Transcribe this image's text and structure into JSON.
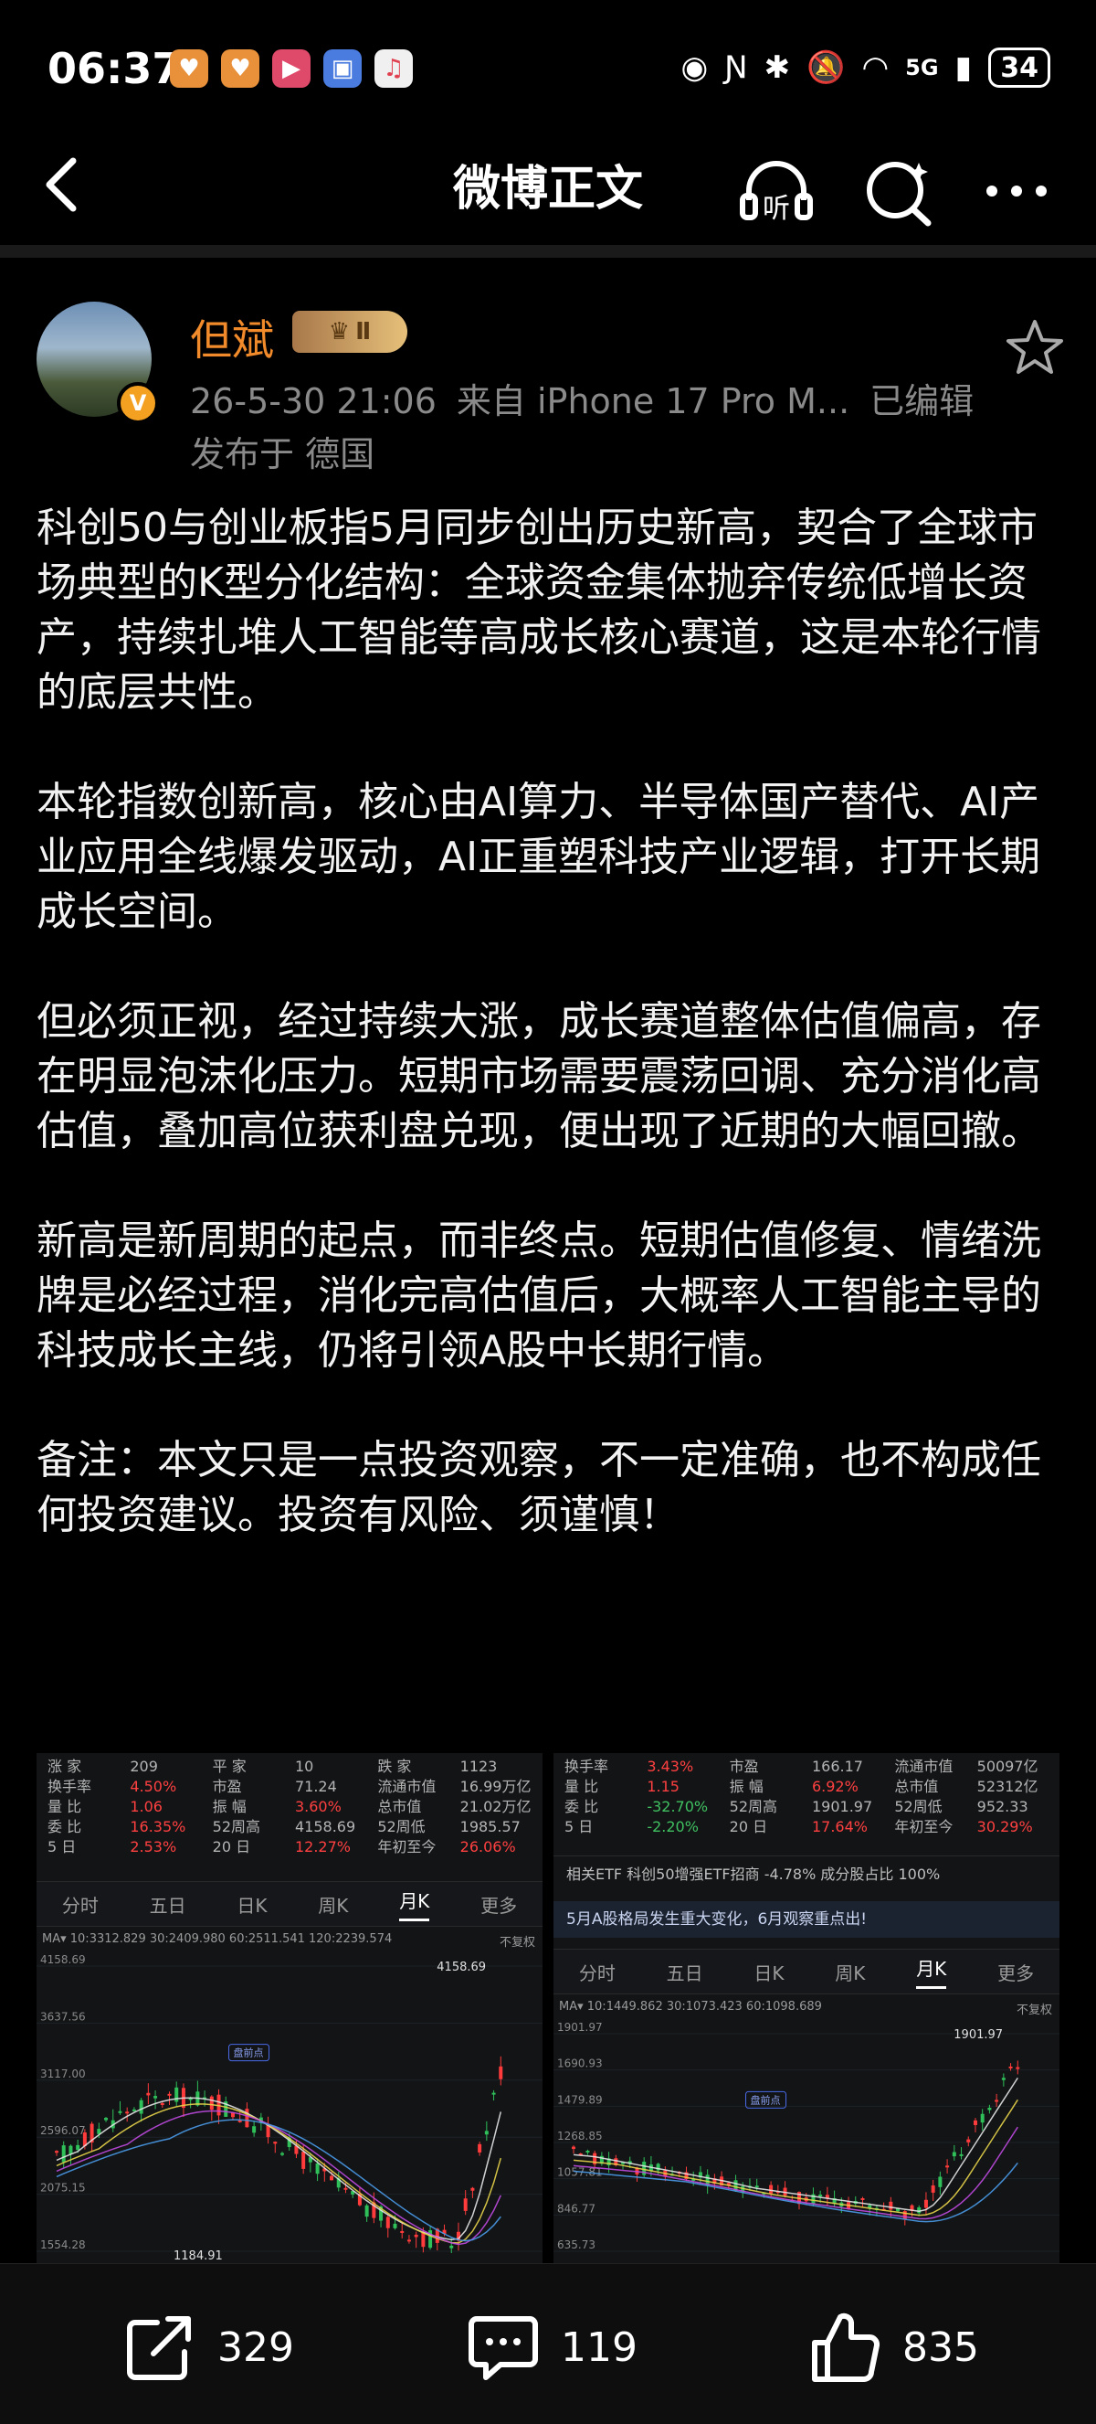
{
  "status_bar": {
    "time": "06:37",
    "network": "5G",
    "battery": "34"
  },
  "nav": {
    "title": "微博正文",
    "listen_label": "听"
  },
  "author": {
    "name": "但斌",
    "level": "Ⅱ",
    "verified_mark": "V",
    "datetime": "26-5-30 21:06",
    "source": "来自 iPhone 17 Pro M...",
    "edited": "已编辑",
    "location": "发布于 德国"
  },
  "post": {
    "paragraphs": [
      "科创50与创业板指5月同步创出历史新高，契合了全球市场典型的K型分化结构：全球资金集体抛弃传统低增长资产，持续扎堆人工智能等高成长核心赛道，这是本轮行情的底层共性。",
      "本轮指数创新高，核心由AI算力、半导体国产替代、AI产业应用全线爆发驱动，AI正重塑科技产业逻辑，打开长期成长空间。",
      "但必须正视，经过持续大涨，成长赛道整体估值偏高，存在明显泡沫化压力。短期市场需要震荡回调、充分消化高估值，叠加高位获利盘兑现，便出现了近期的大幅回撤。",
      "新高是新周期的起点，而非终点。短期估值修复、情绪洗牌是必经过程，消化完高估值后，大概率人工智能主导的科技成长主线，仍将引领A股中长期行情。",
      "备注：本文只是一点投资观察，不一定准确，也不构成任何投资建议。投资有风险、须谨慎！"
    ]
  },
  "image_left": {
    "stats": [
      [
        "涨 家",
        "209",
        "平 家",
        "10",
        "跌 家",
        "1123"
      ],
      [
        "换手率",
        "4.50%",
        "市盈",
        "71.24",
        "流通市值",
        "16.99万亿"
      ],
      [
        "量 比",
        "1.06",
        "振 幅",
        "3.60%",
        "总市值",
        "21.02万亿"
      ],
      [
        "委 比",
        "16.35%",
        "52周高",
        "4158.69",
        "52周低",
        "1985.57"
      ],
      [
        "5 日",
        "2.53%",
        "20 日",
        "12.27%",
        "年初至今",
        "26.06%"
      ]
    ],
    "tabs": [
      "分时",
      "五日",
      "日K",
      "周K",
      "月K",
      "更多"
    ],
    "active_tab": "月K",
    "ma_line": "MA▾ 10:3312.829  30:2409.980  60:2511.541  120:2239.574",
    "adjust": "不复权",
    "y_labels": [
      "4158.69",
      "3637.56",
      "3117.00",
      "2596.07",
      "2075.15",
      "1554.28"
    ],
    "high_label": "4158.69",
    "low_label": "1184.91",
    "tag": "盘前点"
  },
  "image_right": {
    "stats": [
      [
        "换手率",
        "3.43%",
        "市盈",
        "166.17",
        "流通市值",
        "50097亿"
      ],
      [
        "量 比",
        "1.15",
        "振 幅",
        "6.92%",
        "总市值",
        "52312亿"
      ],
      [
        "委 比",
        "-32.70%",
        "52周高",
        "1901.97",
        "52周低",
        "952.33"
      ],
      [
        "5 日",
        "-2.20%",
        "20 日",
        "17.64%",
        "年初至今",
        "30.29%"
      ]
    ],
    "etf_row": "相关ETF  科创50增强ETF招商  -4.78%   成分股占比  100%",
    "notice": "5月A股格局发生重大变化，6月观察重点出!",
    "tabs": [
      "分时",
      "五日",
      "日K",
      "周K",
      "月K",
      "更多"
    ],
    "active_tab": "月K",
    "ma_line": "MA▾ 10:1449.862  30:1073.423  60:1098.689",
    "adjust": "不复权",
    "y_labels": [
      "1901.97",
      "1690.93",
      "1479.89",
      "1268.85",
      "1057.81",
      "846.77",
      "635.73"
    ],
    "high_label": "1901.97",
    "tag": "盘前点"
  },
  "actions": {
    "repost_count": "329",
    "comment_count": "119",
    "like_count": "835"
  },
  "colors": {
    "author_name": "#f08a2a",
    "up": "#ff4040",
    "down": "#40c060"
  }
}
